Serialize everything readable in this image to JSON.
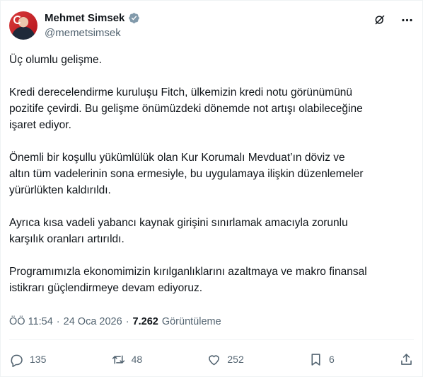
{
  "author": {
    "display_name": "Mehmet Simsek",
    "handle": "@memetsimsek",
    "verified": true
  },
  "header_icons": [
    "grok-icon",
    "more-icon"
  ],
  "tweet": {
    "paragraphs": [
      "Üç olumlu gelişme.",
      "Kredi derecelendirme kuruluşu Fitch, ülkemizin kredi notu görünümünü\npozitife çevirdi. Bu gelişme önümüzdeki dönemde not artışı olabileceğine\nişaret ediyor.",
      "Önemli bir koşullu yükümlülük olan Kur Korumalı Mevduat’ın döviz ve\naltın tüm vadelerinin sona ermesiyle, bu uygulamaya ilişkin düzenlemeler\nyürürlükten kaldırıldı.",
      "Ayrıca kısa vadeli yabancı kaynak girişini sınırlamak amacıyla zorunlu\nkarşılık oranları artırıldı.",
      "Programımızla ekonomimizin kırılganlıklarını azaltmaya ve makro finansal\nistikrarı güçlendirmeye devam ediyoruz."
    ]
  },
  "meta": {
    "time": "ÖÖ 11:54",
    "date": "24 Oca 2026",
    "separator": "·",
    "views": "7.262",
    "views_label": "Görüntüleme"
  },
  "actions": {
    "replies": "135",
    "reposts": "48",
    "likes": "252",
    "bookmarks": "6"
  },
  "colors": {
    "text": "#0f1419",
    "secondary": "#536471",
    "verified": "#829aab",
    "divider": "#eff3f4"
  }
}
